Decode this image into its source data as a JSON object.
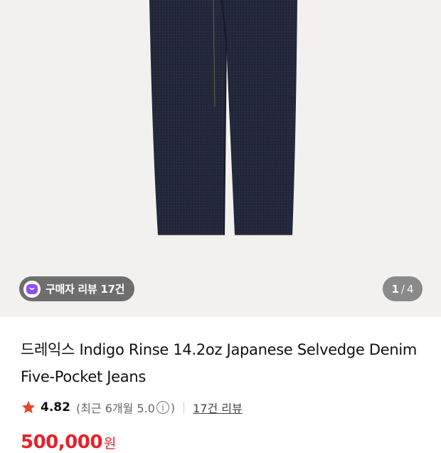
{
  "gallery": {
    "review_chip": {
      "label": "구매자 리뷰 17건"
    },
    "page_indicator": {
      "current": "1",
      "separator": "/",
      "total": "4"
    }
  },
  "product": {
    "title": "드레익스 Indigo Rinse 14.2oz Japanese Selvedge Denim Five-Pocket Jeans",
    "rating": {
      "score": "4.82",
      "recent_prefix": "(최근 6개월 5.0",
      "recent_suffix": ")",
      "review_count_link": "17건 리뷰"
    },
    "price": {
      "amount": "500,000",
      "currency": "원"
    }
  },
  "colors": {
    "accent_red": "#e8202b",
    "star": "#e8452c",
    "chip_bg": "#6e6e6e",
    "chip_icon": "#8a4dff"
  },
  "icons": [
    "review-chip-icon",
    "star-icon",
    "info-icon"
  ]
}
